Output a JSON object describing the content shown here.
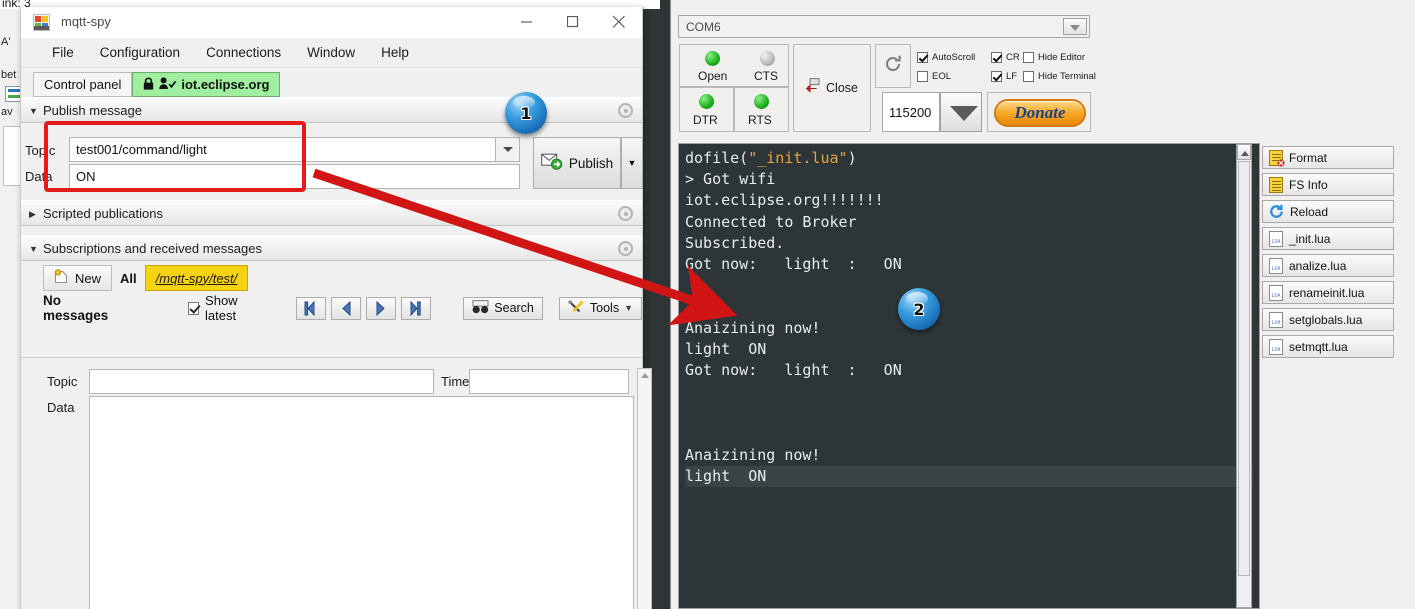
{
  "background": {
    "top_text": "ink: 3",
    "side_items": [
      "A'",
      "bet",
      "av"
    ]
  },
  "mqtt_window": {
    "title": "mqtt-spy",
    "icon": "mqtt-spy-app-icon",
    "window_controls": {
      "minimize": "minimize-icon",
      "maximize": "maximize-icon",
      "close": "close-icon"
    },
    "menu": [
      "File",
      "Configuration",
      "Connections",
      "Window",
      "Help"
    ],
    "tabs": [
      {
        "label": "Control panel",
        "active": false
      },
      {
        "label": "iot.eclipse.org",
        "active": true,
        "icons": [
          "lock-icon",
          "user-check-icon"
        ]
      }
    ],
    "publish_panel": {
      "title": "Publish message",
      "collapsed": false,
      "topic_label": "Topic",
      "topic_value": "test001/command/light",
      "data_label": "Data",
      "data_value": "ON",
      "publish_label": "Publish"
    },
    "scripted_panel": {
      "title": "Scripted publications",
      "collapsed": true
    },
    "subscriptions_panel": {
      "title": "Subscriptions and received messages",
      "collapsed": false,
      "tabs": [
        {
          "label": "New",
          "type": "new"
        },
        {
          "label": "All",
          "type": "all"
        },
        {
          "label": "/mqtt-spy/test/",
          "type": "topic"
        }
      ],
      "status": "No messages",
      "show_latest_label": "Show latest",
      "show_latest_checked": true,
      "nav_buttons": [
        "first-icon",
        "previous-icon",
        "next-icon",
        "last-icon"
      ],
      "search_label": "Search",
      "tools_label": "Tools",
      "detail": {
        "topic_label": "Topic",
        "topic_value": "",
        "time_label": "Time",
        "time_value": "",
        "data_label": "Data",
        "data_value": ""
      }
    }
  },
  "esplorer_window": {
    "port": "COM6",
    "leds": [
      {
        "label": "Open",
        "state": "green"
      },
      {
        "label": "CTS",
        "state": "gray"
      },
      {
        "label": "DTR",
        "state": "green"
      },
      {
        "label": "RTS",
        "state": "green"
      }
    ],
    "close_label": "Close",
    "refresh_icon": "refresh-icon",
    "checkboxes": [
      {
        "label": "AutoScroll",
        "checked": true
      },
      {
        "label": "EOL",
        "checked": false
      },
      {
        "label": "CR",
        "checked": true
      },
      {
        "label": "LF",
        "checked": true
      },
      {
        "label": "Hide Editor",
        "checked": false
      },
      {
        "label": "Hide Terminal",
        "checked": false
      }
    ],
    "baud": "115200",
    "donate_label": "Donate",
    "terminal": {
      "lines": [
        {
          "text": "dofile(",
          "tail": "\"_init.lua\"",
          "close": ")"
        },
        {
          "text": "> Got wifi"
        },
        {
          "text": "iot.eclipse.org!!!!!!!"
        },
        {
          "text": "Connected to Broker"
        },
        {
          "text": "Subscribed."
        },
        {
          "text": "Got now:   light  :   ON"
        },
        {
          "text": ""
        },
        {
          "text": ""
        },
        {
          "text": "Anaizining now!"
        },
        {
          "text": "light  ON"
        },
        {
          "text": "Got now:   light  :   ON"
        },
        {
          "text": ""
        },
        {
          "text": ""
        },
        {
          "text": ""
        },
        {
          "text": "Anaizining now!"
        },
        {
          "text": "light  ON"
        }
      ]
    },
    "file_buttons": [
      {
        "label": "Format",
        "icon": "format-icon"
      },
      {
        "label": "FS Info",
        "icon": "fsinfo-icon"
      },
      {
        "label": "Reload",
        "icon": "reload-icon"
      },
      {
        "label": "_init.lua",
        "icon": "lua-file-icon"
      },
      {
        "label": "analize.lua",
        "icon": "lua-file-icon"
      },
      {
        "label": "renameinit.lua",
        "icon": "lua-file-icon"
      },
      {
        "label": "setglobals.lua",
        "icon": "lua-file-icon"
      },
      {
        "label": "setmqtt.lua",
        "icon": "lua-file-icon"
      }
    ]
  },
  "annotations": {
    "badge_one": "1",
    "badge_two": "2",
    "highlight_color": "#e21b1b",
    "badge_color": "#3a9ede"
  }
}
